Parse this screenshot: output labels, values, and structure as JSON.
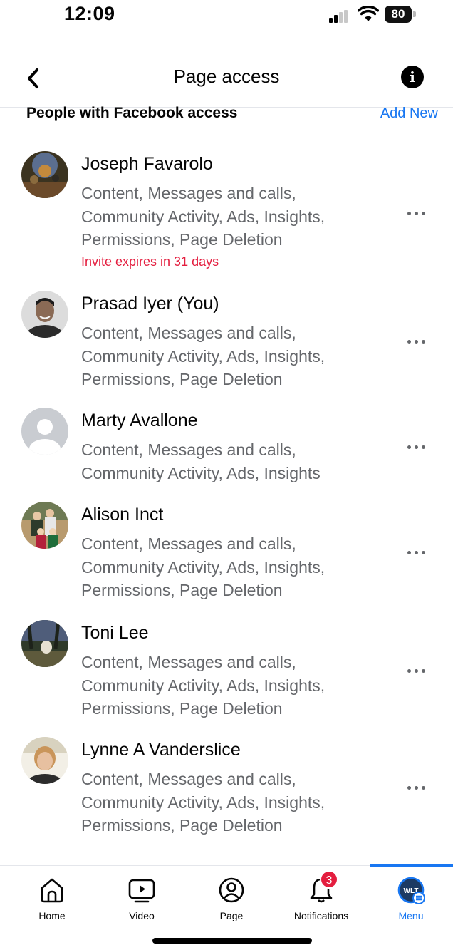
{
  "status_bar": {
    "time": "12:09",
    "battery": "80"
  },
  "header": {
    "title": "Page access",
    "back_icon": "chevron-left-icon",
    "info_icon": "info-icon"
  },
  "section": {
    "title": "People with Facebook access",
    "action": "Add New"
  },
  "people": [
    {
      "name": "Joseph Favarolo",
      "permissions": "Content, Messages and calls, Community Activity, Ads, Insights, Permissions, Page Deletion",
      "note": "Invite expires in 31 days"
    },
    {
      "name": "Prasad Iyer (You)",
      "permissions": "Content, Messages and calls, Community Activity, Ads, Insights, Permissions, Page Deletion",
      "note": ""
    },
    {
      "name": "Marty Avallone",
      "permissions": "Content, Messages and calls, Community Activity, Ads, Insights",
      "note": ""
    },
    {
      "name": "Alison Inct",
      "permissions": "Content, Messages and calls, Community Activity, Ads, Insights, Permissions, Page Deletion",
      "note": ""
    },
    {
      "name": "Toni Lee",
      "permissions": "Content, Messages and calls, Community Activity, Ads, Insights, Permissions, Page Deletion",
      "note": ""
    },
    {
      "name": "Lynne A Vanderslice",
      "permissions": "Content, Messages and calls, Community Activity, Ads, Insights, Permissions, Page Deletion",
      "note": ""
    }
  ],
  "tabs": [
    {
      "label": "Home",
      "icon": "home-icon"
    },
    {
      "label": "Video",
      "icon": "video-icon"
    },
    {
      "label": "Page",
      "icon": "page-profile-icon"
    },
    {
      "label": "Notifications",
      "icon": "bell-icon",
      "badge": "3"
    },
    {
      "label": "Menu",
      "icon": "menu-avatar-icon",
      "avatar_text": "WLT",
      "active": true
    }
  ],
  "colors": {
    "accent": "#1877f2",
    "alert": "#e41e3f",
    "secondary_text": "#65676b"
  }
}
